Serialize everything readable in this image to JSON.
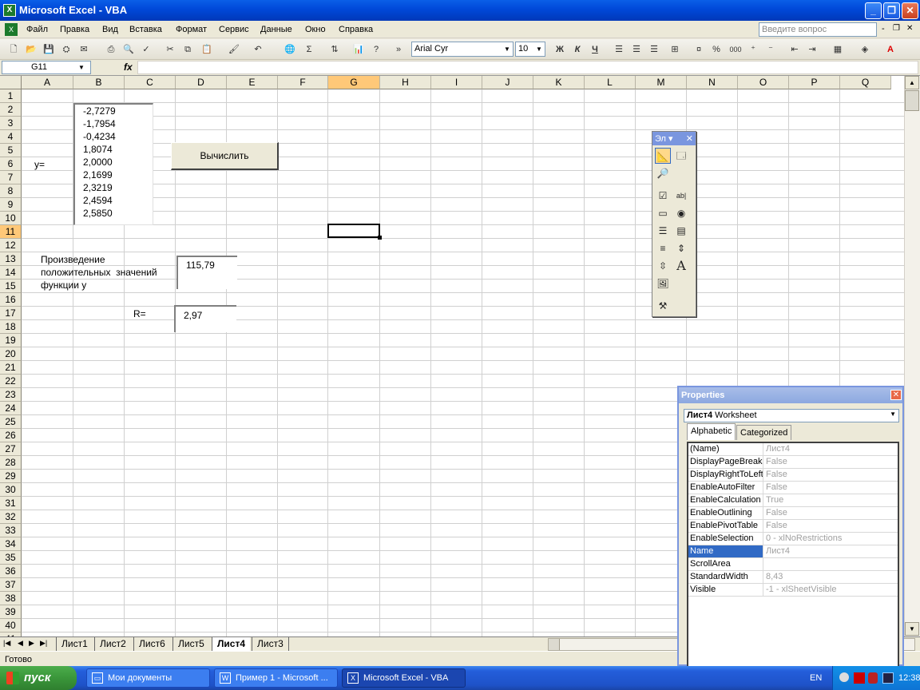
{
  "window": {
    "title": "Microsoft Excel - VBA",
    "min": "_",
    "restore": "❐",
    "close": "✕"
  },
  "menu": {
    "items": [
      "Файл",
      "Правка",
      "Вид",
      "Вставка",
      "Формат",
      "Сервис",
      "Данные",
      "Окно",
      "Справка"
    ],
    "ask_placeholder": "Введите вопрос",
    "doc_min": "-",
    "doc_restore": "❐",
    "doc_close": "✕"
  },
  "toolbar": {
    "font_name": "Arial Cyr",
    "font_size": "10",
    "bold": "Ж",
    "italic": "К",
    "underline": "Ч",
    "percent": "%",
    "thousands": "000",
    "sigma": "Σ"
  },
  "formula_bar": {
    "cell_ref": "G11",
    "fx": "fx",
    "value": ""
  },
  "grid": {
    "columns": [
      "A",
      "B",
      "C",
      "D",
      "E",
      "F",
      "G",
      "H",
      "I",
      "J",
      "K",
      "L",
      "M",
      "N",
      "O",
      "P",
      "Q"
    ],
    "selected_column": "G",
    "selected_row": "11",
    "rows": [
      "1",
      "2",
      "3",
      "4",
      "5",
      "6",
      "7",
      "8",
      "9",
      "10",
      "11",
      "12",
      "13",
      "14",
      "15",
      "16",
      "17",
      "18",
      "19",
      "20",
      "21",
      "22",
      "23",
      "24",
      "25",
      "26",
      "27",
      "28",
      "29",
      "30",
      "31",
      "32",
      "33",
      "34",
      "35",
      "36",
      "37",
      "38",
      "39",
      "40",
      "41"
    ]
  },
  "sheet": {
    "y_label": "y=",
    "list_values": [
      "-2,7279",
      "-1,7954",
      "-0,4234",
      "1,8074",
      "2,0000",
      "2,1699",
      "2,3219",
      "2,4594",
      "2,5850"
    ],
    "calc_button": "Вычислить",
    "product_label_1": "Произведение",
    "product_label_2": "положительных  значений",
    "product_label_3": "функции у",
    "product_value": "115,79",
    "r_label": "R=",
    "r_value": "2,97"
  },
  "toolbox": {
    "title": "Эл",
    "close": "✕"
  },
  "tabs": {
    "sheets": [
      "Лист1",
      "Лист2",
      "Лист6",
      "Лист5",
      "Лист4",
      "Лист3"
    ],
    "active": "Лист4"
  },
  "status": {
    "text": "Готово"
  },
  "properties": {
    "title": "Properties",
    "object_name": "Лист4",
    "object_type": "Worksheet",
    "tab_alphabetic": "Alphabetic",
    "tab_categorized": "Categorized",
    "rows": [
      {
        "name": "(Name)",
        "value": "Лист4"
      },
      {
        "name": "DisplayPageBreaks",
        "value": "False"
      },
      {
        "name": "DisplayRightToLeft",
        "value": "False"
      },
      {
        "name": "EnableAutoFilter",
        "value": "False"
      },
      {
        "name": "EnableCalculation",
        "value": "True"
      },
      {
        "name": "EnableOutlining",
        "value": "False"
      },
      {
        "name": "EnablePivotTable",
        "value": "False"
      },
      {
        "name": "EnableSelection",
        "value": "0 - xlNoRestrictions"
      },
      {
        "name": "Name",
        "value": "Лист4"
      },
      {
        "name": "ScrollArea",
        "value": ""
      },
      {
        "name": "StandardWidth",
        "value": "8,43"
      },
      {
        "name": "Visible",
        "value": "-1 - xlSheetVisible"
      }
    ],
    "selected_row": "Name"
  },
  "taskbar": {
    "start": "пуск",
    "tasks": [
      {
        "label": "Мои документы",
        "active": false
      },
      {
        "label": "Пример 1 - Microsoft ...",
        "active": false
      },
      {
        "label": "Microsoft Excel - VBA",
        "active": true
      }
    ],
    "lang": "EN",
    "clock": "12:38"
  },
  "colors": {
    "title_bar": "#0048d8",
    "selection_header": "#ffc878",
    "taskbar": "#245edb",
    "start_button": "#3a963a"
  }
}
